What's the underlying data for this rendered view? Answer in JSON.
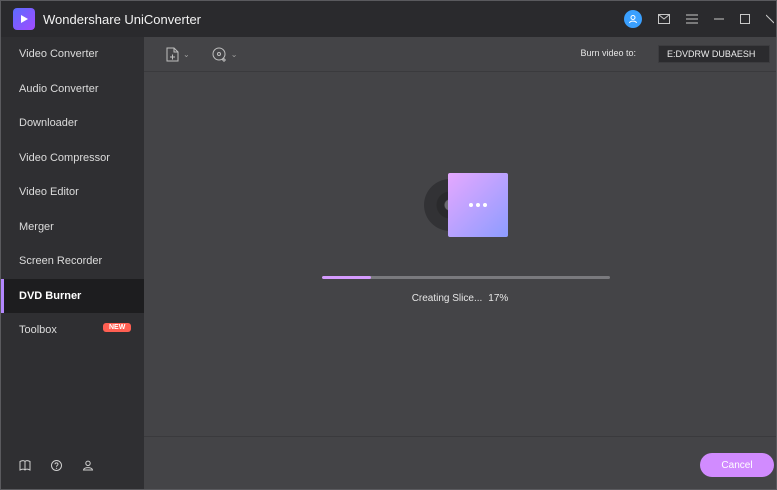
{
  "app": {
    "title": "Wondershare UniConverter"
  },
  "sidebar": {
    "items": [
      {
        "label": "Video Converter"
      },
      {
        "label": "Audio Converter"
      },
      {
        "label": "Downloader"
      },
      {
        "label": "Video Compressor"
      },
      {
        "label": "Video Editor"
      },
      {
        "label": "Merger"
      },
      {
        "label": "Screen Recorder"
      },
      {
        "label": "DVD Burner",
        "active": true
      },
      {
        "label": "Toolbox",
        "badge": "NEW"
      }
    ],
    "bottom_icons": [
      "guide-book-icon",
      "help-icon",
      "community-icon"
    ]
  },
  "toolbar": {
    "burn_label": "Burn video to:",
    "burn_target": "E:DVDRW  DUBAESH",
    "icons": [
      "add-file-icon",
      "load-disc-icon"
    ]
  },
  "progress": {
    "status": "Creating Slice...",
    "percent_text": "17%",
    "percent": 17
  },
  "footer": {
    "cancel_label": "Cancel"
  },
  "colors": {
    "accent": "#d18bff",
    "avatar": "#3aa0ff",
    "badge": "#ff5f52"
  }
}
